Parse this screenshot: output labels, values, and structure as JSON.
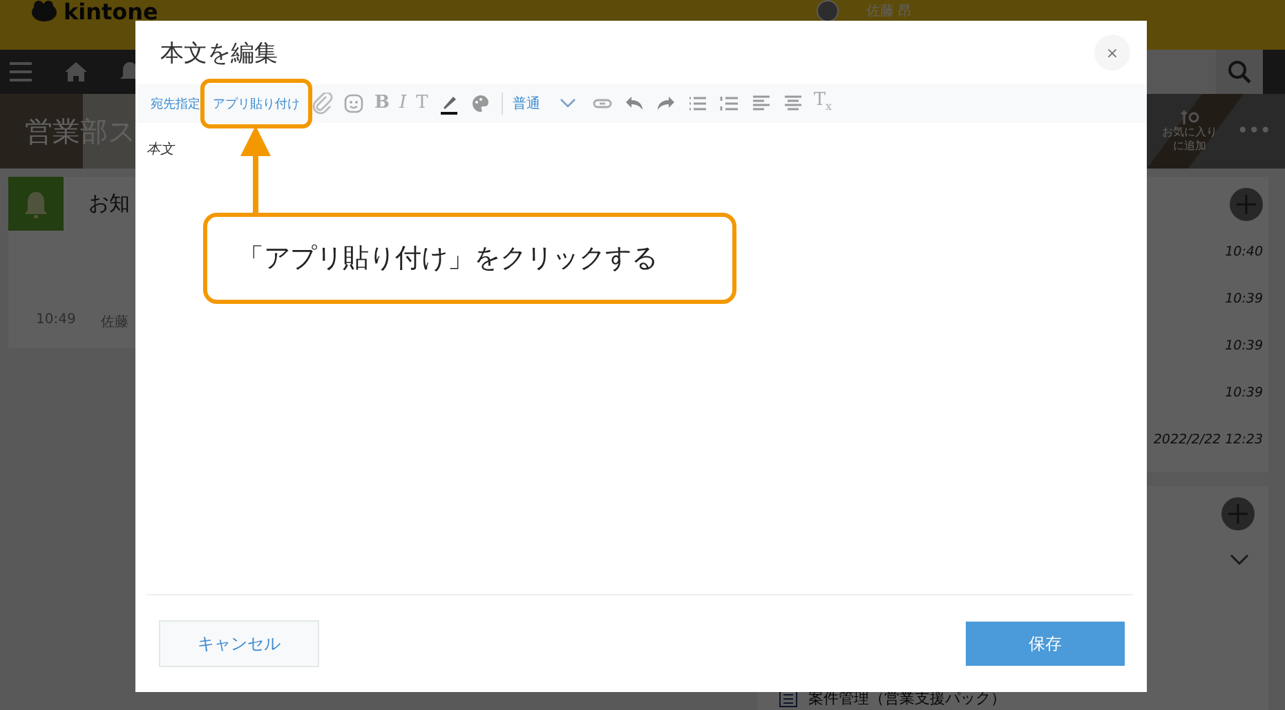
{
  "background": {
    "logo": "kintone",
    "user_name": "佐藤 昂",
    "space_title": "営業部ス",
    "favorite_lines": [
      "お気に入り",
      "に追加"
    ],
    "more": "•••",
    "notice": {
      "title": "お知",
      "time": "10:49",
      "author": "佐藤"
    },
    "times": [
      "10:40",
      "10:39",
      "10:39",
      "10:39",
      "2022/2/22 12:23"
    ],
    "app_item": "案件管理（営業支援パック）"
  },
  "dialog": {
    "title": "本文を編集",
    "close": "×",
    "toolbar": [
      {
        "kind": "link",
        "label": "宛先指定"
      },
      {
        "kind": "link",
        "label": "アプリ貼り付け"
      },
      {
        "kind": "icon"
      },
      {
        "kind": "icon"
      },
      {
        "kind": "glyph",
        "label": "B"
      },
      {
        "kind": "glyph",
        "label": "I"
      },
      {
        "kind": "glyph",
        "label": "T"
      },
      {
        "kind": "icon"
      },
      {
        "kind": "icon"
      },
      {
        "kind": "dropdown",
        "label": "普通"
      },
      {
        "kind": "icon"
      },
      {
        "kind": "icon"
      },
      {
        "kind": "icon"
      },
      {
        "kind": "icon"
      },
      {
        "kind": "icon"
      },
      {
        "kind": "icon"
      },
      {
        "kind": "icon"
      },
      {
        "kind": "glyph",
        "label": "T$_{x}$"
      }
    ],
    "editor_label": "本文",
    "cancel": "キャンセル",
    "save": "保存"
  },
  "annotation": {
    "text": "「アプリ貼り付け」をクリックする"
  }
}
